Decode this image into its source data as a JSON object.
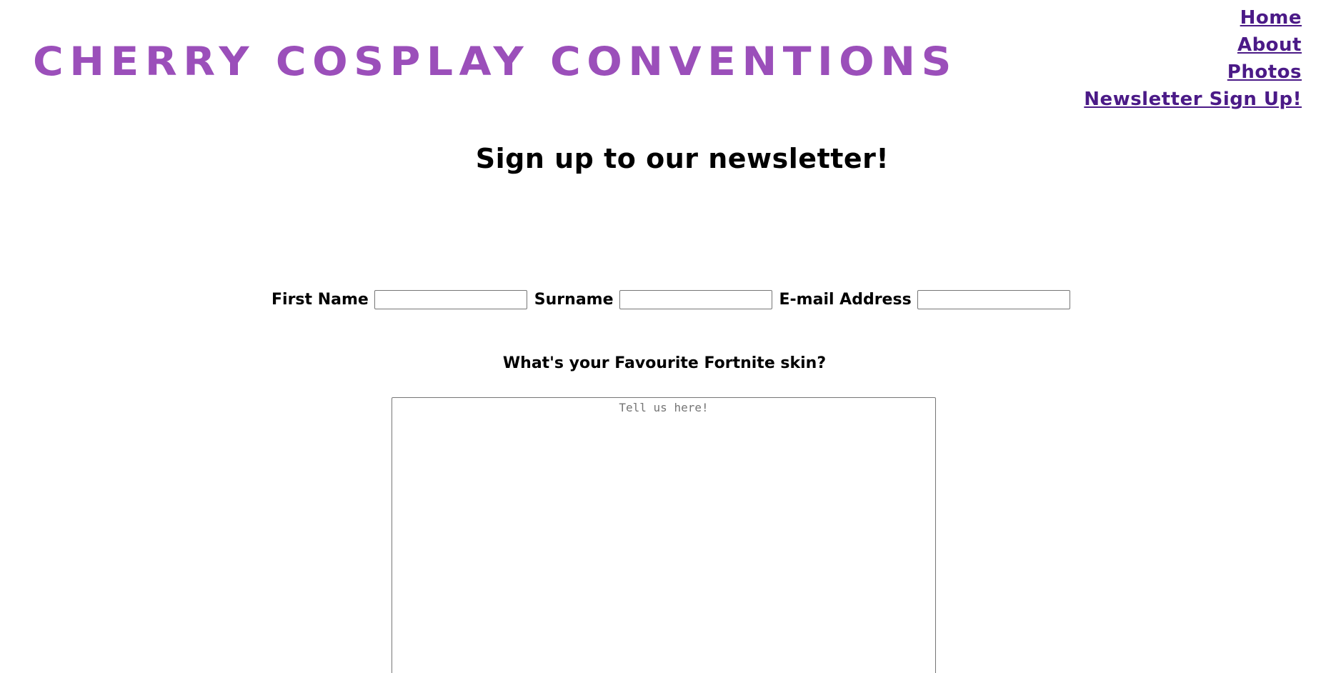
{
  "header": {
    "site_title": "CHERRY COSPLAY CONVENTIONS"
  },
  "nav": {
    "items": [
      {
        "label": "Home"
      },
      {
        "label": "About"
      },
      {
        "label": "Photos"
      },
      {
        "label": "Newsletter Sign Up!"
      }
    ]
  },
  "main": {
    "heading": "Sign up to our newsletter!",
    "form": {
      "first_name_label": "First Name",
      "first_name_value": "",
      "surname_label": "Surname",
      "surname_value": "",
      "email_label": "E-mail Address",
      "email_value": "",
      "question": "What's your Favourite Fortnite skin?",
      "answer_placeholder": "Tell us here!",
      "answer_value": ""
    }
  },
  "colors": {
    "title": "#9b4fba",
    "nav_link": "#4b1a87",
    "text": "#000000",
    "background": "#ffffff",
    "input_border": "#767676"
  }
}
